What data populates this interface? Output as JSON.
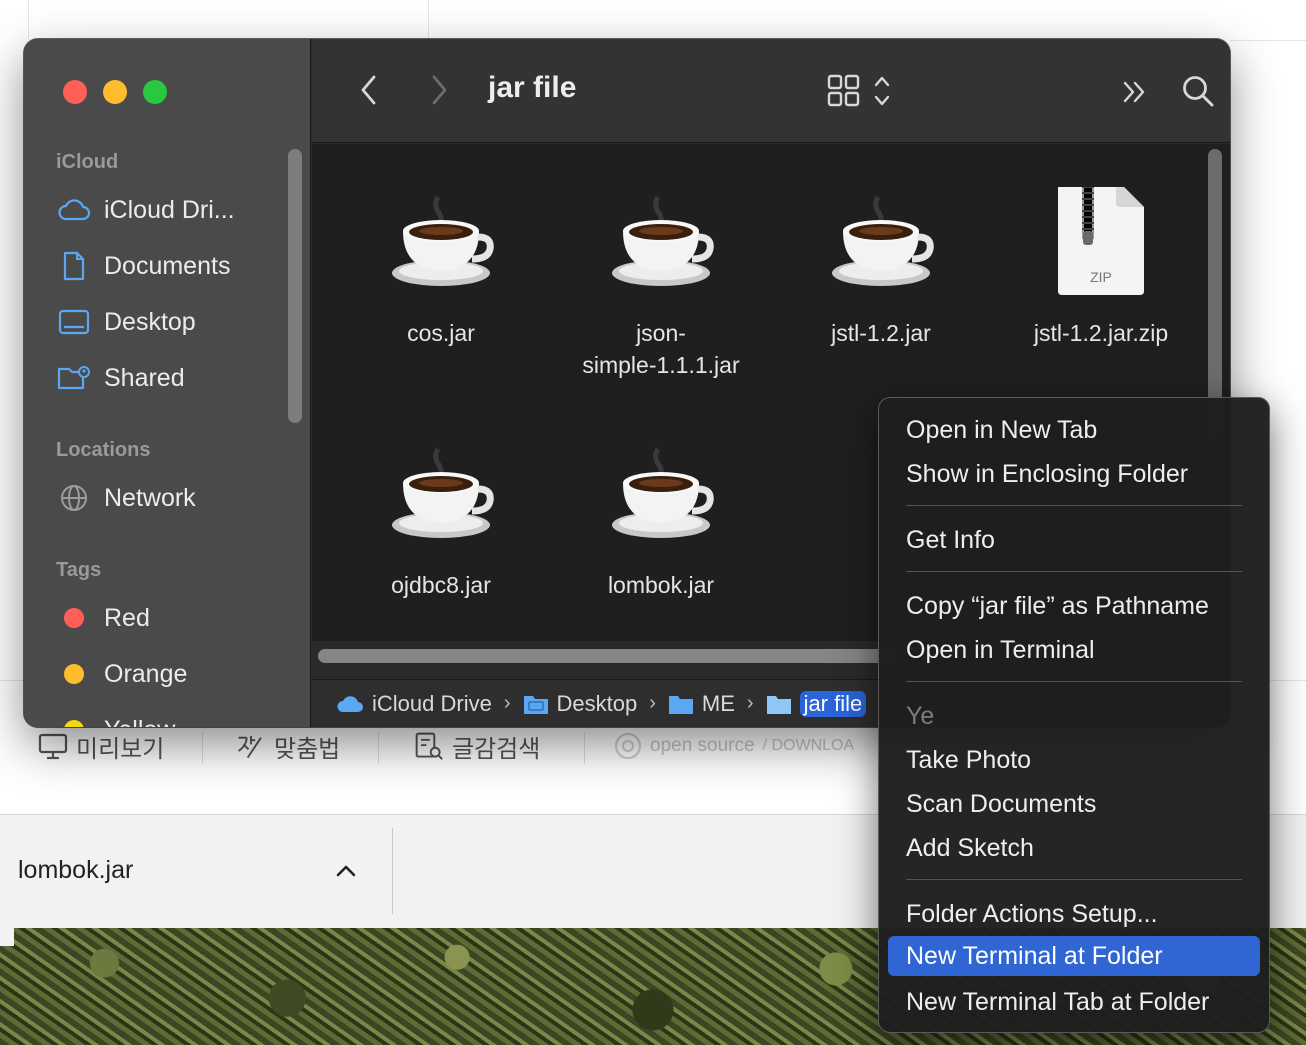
{
  "finder": {
    "title": "jar file",
    "sidebar": {
      "sections": {
        "icloud": "iCloud",
        "locations": "Locations",
        "tags": "Tags"
      },
      "icloud_items": [
        "iCloud Dri...",
        "Documents",
        "Desktop",
        "Shared"
      ],
      "location_items": [
        "Network"
      ],
      "tag_items": [
        {
          "label": "Red",
          "color": "#fe5f57"
        },
        {
          "label": "Orange",
          "color": "#febc2e"
        },
        {
          "label": "Yellow",
          "color": "#f5d90a"
        }
      ]
    },
    "files": [
      {
        "name": "cos.jar",
        "icon": "java-coffee-cup-icon"
      },
      {
        "name": "json-\nsimple-1.1.1.jar",
        "icon": "java-coffee-cup-icon"
      },
      {
        "name": "jstl-1.2.jar",
        "icon": "java-coffee-cup-icon"
      },
      {
        "name": "jstl-1.2.jar.zip",
        "icon": "zip-archive-icon",
        "badge": "ZIP"
      },
      {
        "name": "ojdbc8.jar",
        "icon": "java-coffee-cup-icon"
      },
      {
        "name": "lombok.jar",
        "icon": "java-coffee-cup-icon"
      }
    ],
    "path_bar": [
      "iCloud Drive",
      "Desktop",
      "ME",
      "jar file"
    ]
  },
  "context_menu": {
    "items": [
      {
        "label": "Open in New Tab"
      },
      {
        "label": "Show in Enclosing Folder"
      },
      {
        "separator": true
      },
      {
        "label": "Get Info"
      },
      {
        "separator": true
      },
      {
        "label": "Copy “jar file” as Pathname"
      },
      {
        "label": "Open in Terminal"
      },
      {
        "separator": true
      },
      {
        "label": "Ye",
        "header": true
      },
      {
        "label": "Take Photo"
      },
      {
        "label": "Scan Documents"
      },
      {
        "label": "Add Sketch"
      },
      {
        "separator": true
      },
      {
        "label": "Folder Actions Setup..."
      },
      {
        "label": "New Terminal at Folder",
        "highlighted": true
      },
      {
        "label": "New Terminal Tab at Folder"
      }
    ],
    "highlight_color": "#2f66d4"
  },
  "background": {
    "toolbar": {
      "preview": "미리보기",
      "spellcheck": "맞춤법",
      "char_search": "글감검색",
      "open_source": "open source",
      "downloads": "/ DOWNLOA"
    },
    "download_bar": {
      "file_name": "lombok.jar"
    }
  }
}
